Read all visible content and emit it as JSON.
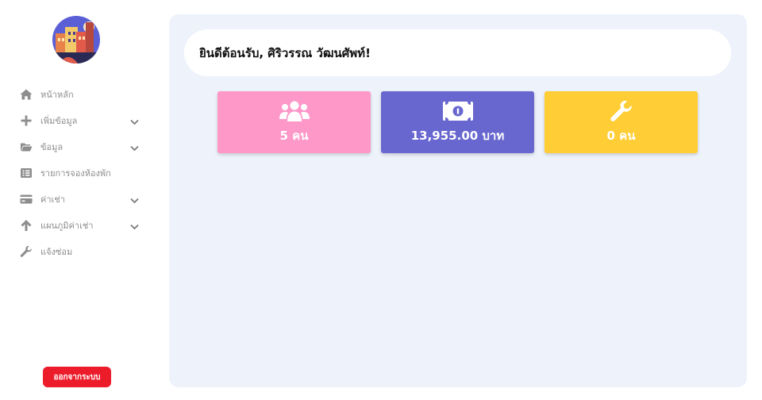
{
  "sidebar": {
    "logo_icon": "building-logo-icon",
    "items": [
      {
        "label": "หน้าหลัก",
        "icon": "home-icon",
        "has_submenu": false
      },
      {
        "label": "เพิ่มข้อมูล",
        "icon": "plus-icon",
        "has_submenu": true
      },
      {
        "label": "ข้อมูล",
        "icon": "folder-icon",
        "has_submenu": true
      },
      {
        "label": "รายการจองห้องพัก",
        "icon": "list-icon",
        "has_submenu": false
      },
      {
        "label": "ค่าเช่า",
        "icon": "credit-card-icon",
        "has_submenu": true
      },
      {
        "label": "แผนภูมิค่าเช่า",
        "icon": "arrow-up-icon",
        "has_submenu": true
      },
      {
        "label": "แจ้งซ่อม",
        "icon": "wrench-icon",
        "has_submenu": false
      }
    ],
    "logout_label": "ออกจากระบบ"
  },
  "main": {
    "welcome": "ยินดีต้อนรับ, ศิริวรรณ วัฒนศัพท์!",
    "cards": [
      {
        "icon": "users-icon",
        "value": "5 คน",
        "color": "#fd98c9"
      },
      {
        "icon": "money-bill-icon",
        "value": "13,955.00 บาท",
        "color": "#6867cf"
      },
      {
        "icon": "wrench-icon",
        "value": "0 คน",
        "color": "#ffcd35"
      }
    ]
  },
  "colors": {
    "sidebar_text": "#8d8d8d",
    "main_bg": "#eef3fb",
    "logout": "#ec1c2b"
  }
}
